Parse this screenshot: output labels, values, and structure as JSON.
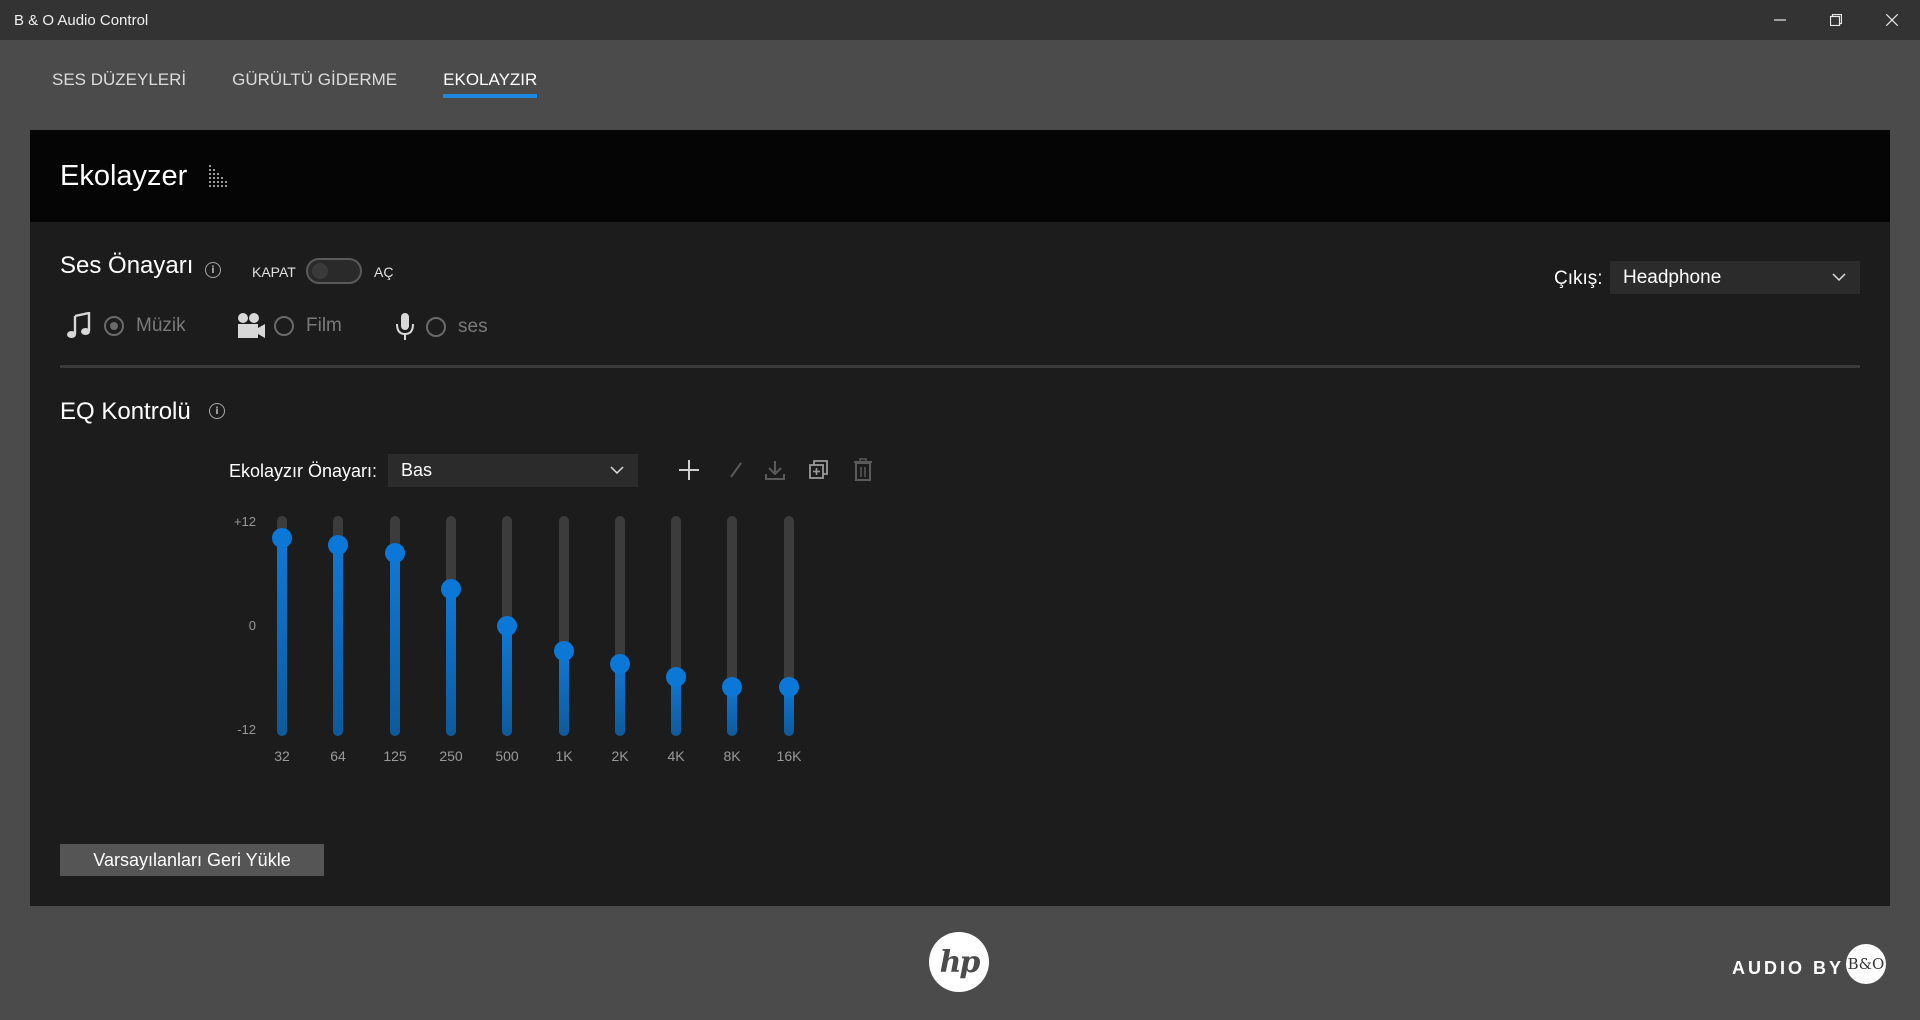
{
  "window": {
    "title": "B & O Audio Control"
  },
  "tabs": [
    {
      "label": "SES DÜZEYLERİ",
      "active": false
    },
    {
      "label": "GÜRÜLTÜ GİDERME",
      "active": false
    },
    {
      "label": "EKOLAYZIR",
      "active": true
    }
  ],
  "panel": {
    "title": "Ekolayzer",
    "title_icon": "equalizer-icon"
  },
  "sound_preset": {
    "title": "Ses Önayarı",
    "info_icon": "info-icon",
    "toggle_off_label": "KAPAT",
    "toggle_on_label": "AÇ",
    "toggle_state": "off",
    "options": [
      {
        "label": "Müzik",
        "icon": "music-note-icon",
        "checked": true
      },
      {
        "label": "Film",
        "icon": "camera-icon",
        "checked": false
      },
      {
        "label": "ses",
        "icon": "microphone-icon",
        "checked": false
      }
    ]
  },
  "output": {
    "label": "Çıkış:",
    "value": "Headphone"
  },
  "eq_control": {
    "title": "EQ Kontrolü",
    "preset_label": "Ekolayzır Önayarı:",
    "preset_value": "Bas",
    "tools": [
      "add-icon",
      "edit-icon",
      "download-icon",
      "copy-icon",
      "delete-icon"
    ],
    "db_labels": {
      "max": "+12",
      "mid": "0",
      "min": "-12"
    },
    "bands": [
      {
        "freq": "32",
        "gain": 9.6
      },
      {
        "freq": "64",
        "gain": 8.8
      },
      {
        "freq": "125",
        "gain": 8.0
      },
      {
        "freq": "250",
        "gain": 4.0
      },
      {
        "freq": "500",
        "gain": 0.0
      },
      {
        "freq": "1K",
        "gain": -2.7
      },
      {
        "freq": "2K",
        "gain": -4.2
      },
      {
        "freq": "4K",
        "gain": -5.6
      },
      {
        "freq": "8K",
        "gain": -6.7
      },
      {
        "freq": "16K",
        "gain": -6.7
      }
    ]
  },
  "reset_button": {
    "label": "Varsayılanları Geri Yükle"
  },
  "footer": {
    "audio_by": "AUDIO BY",
    "hp_logo": "hp",
    "bo_logo": "B&O"
  },
  "colors": {
    "accent": "#0b78d7",
    "panel": "#1c1c1c",
    "header": "#050505",
    "background": "#4b4b4b"
  }
}
